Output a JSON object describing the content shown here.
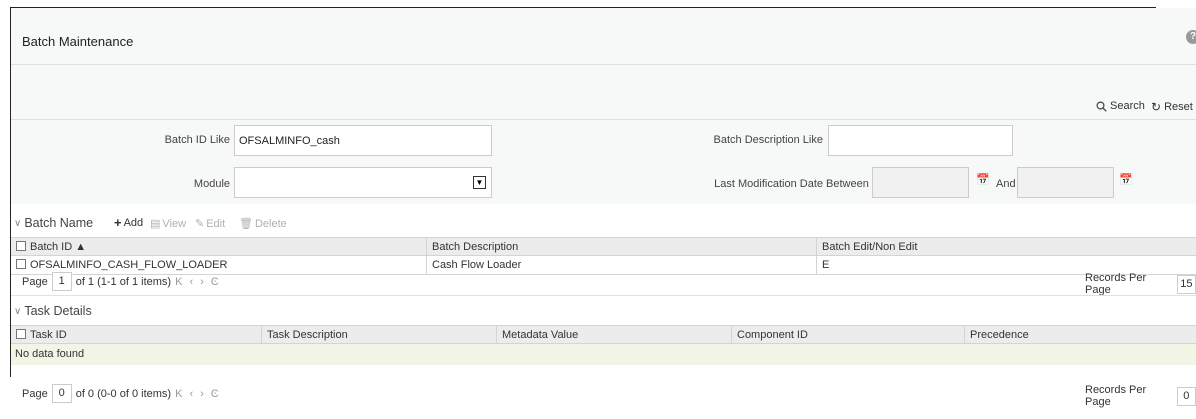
{
  "page": {
    "title": "Batch Maintenance",
    "help": "?"
  },
  "toolbar": {
    "search_label": "Search",
    "reset_label": "Reset"
  },
  "search": {
    "batch_id_label": "Batch ID Like",
    "batch_id_value": "OFSALMINFO_cash",
    "batch_desc_label": "Batch Description Like",
    "batch_desc_value": "",
    "module_label": "Module",
    "module_value": "",
    "last_mod_label": "Last Modification Date",
    "between_label": "Between",
    "and_label": "And",
    "from_date": "",
    "to_date": ""
  },
  "batch_section": {
    "title": "Batch Name",
    "actions": {
      "add": "Add",
      "view": "View",
      "edit": "Edit",
      "delete": "Delete"
    },
    "columns": [
      "Batch ID ▲",
      "Batch Description",
      "Batch Edit/Non Edit"
    ],
    "rows": [
      {
        "batch_id": "OFSALMINFO_CASH_FLOW_LOADER",
        "description": "Cash Flow Loader",
        "edit_flag": "E"
      }
    ],
    "pager": {
      "page_label": "Page",
      "page": "1",
      "summary": "of 1 (1-1 of 1 items)",
      "nav": "K ‹ › Ͼ",
      "rpp_label": "Records Per Page",
      "rpp": "15"
    }
  },
  "task_section": {
    "title": "Task Details",
    "columns": [
      "Task ID",
      "Task Description",
      "Metadata Value",
      "Component ID",
      "Precedence"
    ],
    "empty_text": "No data found",
    "pager": {
      "page_label": "Page",
      "page": "0",
      "summary": "of 0 (0-0 of 0 items)",
      "nav": "K ‹ › Ͼ",
      "rpp_label": "Records Per Page",
      "rpp": "0"
    }
  },
  "colors": {
    "header_bg": "#f7f8f8",
    "grid_header_bg": "#ececec",
    "empty_row_bg": "#f2f5e6"
  }
}
